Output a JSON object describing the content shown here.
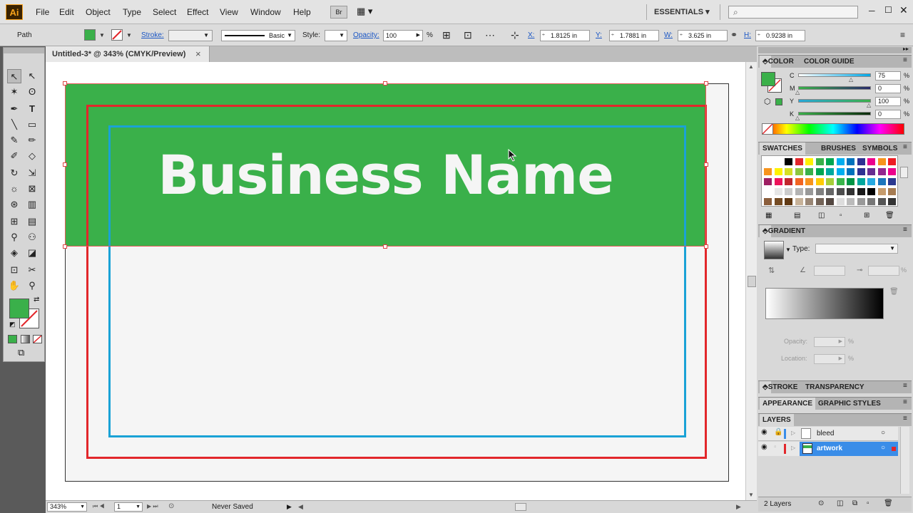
{
  "app": {
    "logo": "Ai"
  },
  "menu": [
    "File",
    "Edit",
    "Object",
    "Type",
    "Select",
    "Effect",
    "View",
    "Window",
    "Help"
  ],
  "workspace": {
    "label": "ESSENTIALS"
  },
  "control": {
    "selection_type": "Path",
    "stroke_label": "Stroke:",
    "brush_label": "Basic",
    "style_label": "Style:",
    "opacity_label": "Opacity:",
    "opacity_value": "100",
    "opacity_unit": "%",
    "x_label": "X:",
    "x_value": "1.8125 in",
    "y_label": "Y:",
    "y_value": "1.7881 in",
    "w_label": "W:",
    "w_value": "3.625 in",
    "h_label": "H:",
    "h_value": "0.9238 in"
  },
  "document": {
    "tab_title": "Untitled-3* @ 343% (CMYK/Preview)",
    "close": "×"
  },
  "artwork": {
    "headline": "Business Name"
  },
  "colors": {
    "fill": "#3ab04a",
    "bleed": "#e2272b",
    "safe": "#1aa2d6",
    "accent": "#3a8de8"
  },
  "status": {
    "zoom": "343%",
    "page": "1",
    "saved": "Never Saved"
  },
  "panels": {
    "color": {
      "tabs": [
        "COLOR",
        "COLOR GUIDE"
      ],
      "channels": [
        {
          "label": "C",
          "value": "75",
          "unit": "%",
          "level": 0.75
        },
        {
          "label": "M",
          "value": "0",
          "unit": "%",
          "level": 0
        },
        {
          "label": "Y",
          "value": "100",
          "unit": "%",
          "level": 1
        },
        {
          "label": "K",
          "value": "0",
          "unit": "%",
          "level": 0
        }
      ]
    },
    "swatches": {
      "tabs": [
        "SWATCHES",
        "BRUSHES",
        "SYMBOLS"
      ]
    },
    "gradient": {
      "tab": "GRADIENT",
      "type_label": "Type:",
      "opacity_label": "Opacity:",
      "location_label": "Location:",
      "unit": "%"
    },
    "stroke": {
      "tabs": [
        "STROKE",
        "TRANSPARENCY"
      ]
    },
    "appearance": {
      "tabs": [
        "APPEARANCE",
        "GRAPHIC STYLES"
      ]
    },
    "layers": {
      "tab": "LAYERS",
      "items": [
        {
          "name": "bleed",
          "selected": false
        },
        {
          "name": "artwork",
          "selected": true
        }
      ],
      "count": "2 Layers"
    }
  }
}
